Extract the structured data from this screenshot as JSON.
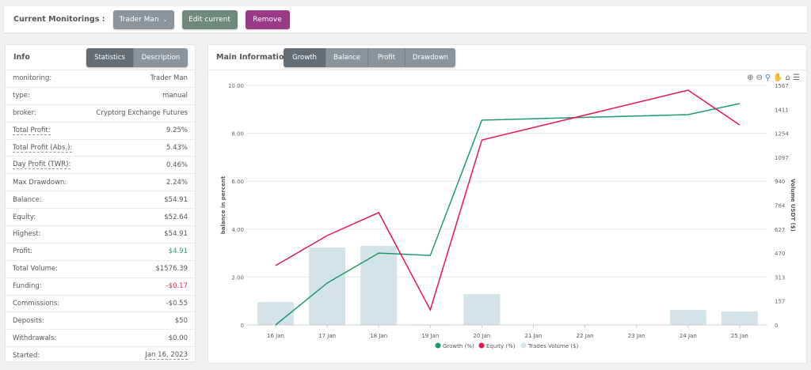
{
  "topbar": {
    "label": "Current Monitorings :",
    "select": "Trader Man",
    "edit": "Edit current",
    "remove": "Remove"
  },
  "info": {
    "title": "Info",
    "tabs": [
      "Statistics",
      "Description"
    ],
    "rows": [
      {
        "k": "monitoring:",
        "v": "Trader Man"
      },
      {
        "k": "type:",
        "v": "manual"
      },
      {
        "k": "broker:",
        "v": "Cryptorg Exchange Futures"
      },
      {
        "k": "Total Profit:",
        "v": "9.25%",
        "ku": true
      },
      {
        "k": "Total Profit (Abs.):",
        "v": "5.43%",
        "ku": true
      },
      {
        "k": "Day Profit (TWR):",
        "v": "0.46%",
        "ku": true
      },
      {
        "k": "Max Drawdown:",
        "v": "2.24%"
      },
      {
        "k": "Balance:",
        "v": "$54.91"
      },
      {
        "k": "Equity:",
        "v": "$52.64"
      },
      {
        "k": "Highest:",
        "v": "$54.91"
      },
      {
        "k": "Profit:",
        "v": "$4.91",
        "color": "#2e9b6e"
      },
      {
        "k": "Total Volume:",
        "v": "$1576.39"
      },
      {
        "k": "Funding:",
        "v": "-$0.17",
        "color": "#e0294f"
      },
      {
        "k": "Commissions:",
        "v": "-$0.55"
      },
      {
        "k": "Deposits:",
        "v": "$50"
      },
      {
        "k": "Withdrawals:",
        "v": "$0.00"
      },
      {
        "k": "Started:",
        "v": "Jan 16, 2023",
        "vu": true
      }
    ]
  },
  "main": {
    "title": "Main Information",
    "tabs": [
      "Growth",
      "Balance",
      "Profit",
      "Drawdown"
    ]
  },
  "colors": {
    "growth": "#1f9a6b",
    "equity": "#e3174f",
    "volume": "#d3e3e7",
    "select": "#8b949b",
    "edit": "#6f8a7d",
    "remove": "#983a85"
  },
  "chart_data": {
    "type": "line+bar",
    "categories": [
      "16 Jan",
      "17 Jan",
      "18 Jan",
      "19 Jan",
      "20 Jan",
      "21 Jan",
      "22 Jan",
      "23 Jan",
      "24 Jan",
      "25 Jan"
    ],
    "ylabel": "balance in percent",
    "ylabel_right": "Volume USDT ($)",
    "ylim": [
      0,
      10
    ],
    "yticks": [
      "0",
      "2.00",
      "4.00",
      "6.00",
      "8.00",
      "10.00"
    ],
    "ylim_right": [
      0,
      1567
    ],
    "yticks_right": [
      "0",
      "157",
      "313",
      "470",
      "627",
      "784",
      "940",
      "1097",
      "1254",
      "1411",
      "1567"
    ],
    "series": [
      {
        "name": "Growth (%)",
        "type": "line",
        "values": [
          0,
          1.75,
          3.0,
          2.9,
          8.55,
          null,
          null,
          null,
          8.78,
          9.24
        ]
      },
      {
        "name": "Equity (%)",
        "type": "line",
        "values": [
          2.48,
          3.73,
          4.69,
          0.63,
          7.72,
          null,
          null,
          null,
          9.8,
          8.35
        ]
      },
      {
        "name": "Trades Volume ($)",
        "type": "bar",
        "axis": "right",
        "values": [
          150,
          507,
          517,
          3,
          202,
          0,
          0,
          0,
          98,
          88
        ]
      }
    ],
    "legend": "bottom",
    "grid": true
  }
}
